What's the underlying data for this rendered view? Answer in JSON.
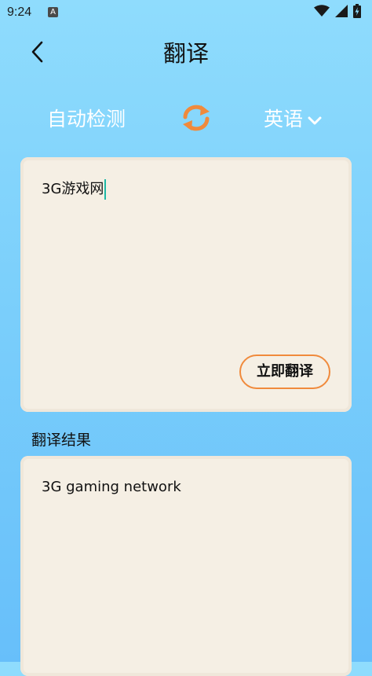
{
  "status_bar": {
    "time": "9:24",
    "notification_icon": "A"
  },
  "header": {
    "title": "翻译"
  },
  "lang_bar": {
    "source": "自动检测",
    "target": "英语"
  },
  "input": {
    "text": "3G游戏网",
    "translate_button": "立即翻译"
  },
  "result": {
    "label": "翻译结果",
    "text": "3G gaming network"
  },
  "colors": {
    "accent": "#f08a3c",
    "card": "#f5efe4",
    "caret": "#1eb8a6"
  },
  "icons": {
    "back": "chevron-left-icon",
    "swap": "swap-refresh-icon",
    "dropdown": "chevron-down-icon",
    "wifi": "wifi-icon",
    "signal": "cell-signal-icon",
    "battery": "battery-charging-icon"
  }
}
